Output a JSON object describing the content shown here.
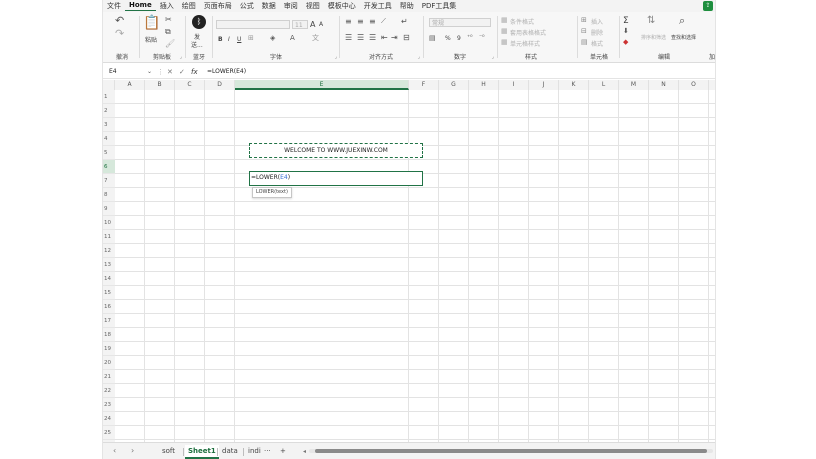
{
  "menu": {
    "tabs": [
      "文件",
      "Home",
      "插入",
      "绘图",
      "页面布局",
      "公式",
      "数据",
      "审阅",
      "视图",
      "模板中心",
      "开发工具",
      "帮助",
      "PDF工具集"
    ],
    "active_tab": "Home"
  },
  "ribbon": {
    "undo_group_label": "撤消",
    "clipboard": {
      "paste_label": "粘贴",
      "group_label": "剪贴板"
    },
    "bluetooth": {
      "label_top": "发",
      "label_bottom": "送...",
      "group_label": "蓝牙"
    },
    "font": {
      "font_size": "11",
      "group_label": "字体",
      "bold": "B",
      "italic": "I",
      "underline": "U",
      "grow": "A",
      "shrink": "A"
    },
    "alignment": {
      "group_label": "对齐方式"
    },
    "number": {
      "format": "常规",
      "percent": "%",
      "comma": "9",
      "group_label": "数字"
    },
    "styles": {
      "conditional": "条件格式",
      "table_format": "套用表格格式",
      "cell_styles": "单元格样式",
      "group_label": "样式"
    },
    "cells": {
      "insert": "插入",
      "delete": "删除",
      "format": "格式",
      "group_label": "单元格"
    },
    "editing": {
      "sum": "Σ",
      "sort_filter": "排序和筛选",
      "find_select": "查找和选择",
      "group_label": "编辑"
    },
    "extra_label": "加"
  },
  "formula_bar": {
    "name_box": "E4",
    "cancel": "✕",
    "enter": "✓",
    "fx": "fx",
    "formula": "=LOWER(E4)"
  },
  "grid": {
    "columns": [
      "A",
      "B",
      "C",
      "D",
      "E",
      "F",
      "G",
      "H",
      "I",
      "J",
      "K",
      "L",
      "M",
      "N",
      "O"
    ],
    "rows": [
      "1",
      "2",
      "3",
      "4",
      "5",
      "6",
      "7",
      "8",
      "9",
      "10",
      "11",
      "12",
      "13",
      "14",
      "15",
      "16",
      "17",
      "18",
      "19",
      "20",
      "21",
      "22",
      "23",
      "24",
      "25"
    ],
    "selected_column": "E",
    "selected_row": "6",
    "e4_value": "WELCOME TO WWW.JUEXINW.COM",
    "e6_prefix": "=LOWER(",
    "e6_ref": "E4",
    "e6_suffix": ")",
    "tooltip": "LOWER(text)"
  },
  "sheets": {
    "tabs": [
      "soft",
      "Sheet1",
      "data",
      "indi"
    ],
    "active": "Sheet1",
    "more": "···",
    "add": "+"
  },
  "colors": {
    "accent": "#217346",
    "ref": "#3a6fd6"
  }
}
